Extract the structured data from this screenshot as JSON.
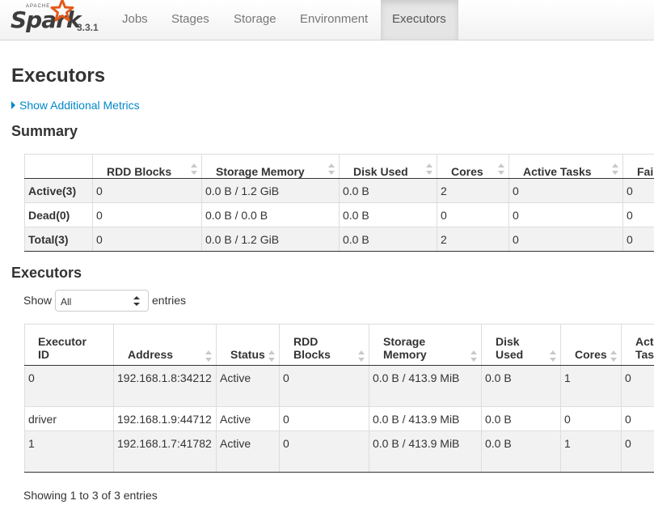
{
  "brand": {
    "apache": "APACHE",
    "name": "Spark",
    "version": "3.3.1"
  },
  "nav": {
    "tabs": [
      {
        "label": "Jobs"
      },
      {
        "label": "Stages"
      },
      {
        "label": "Storage"
      },
      {
        "label": "Environment"
      },
      {
        "label": "Executors",
        "active": true
      }
    ]
  },
  "page": {
    "title": "Executors",
    "toggle_label": "Show Additional Metrics"
  },
  "summary": {
    "title": "Summary",
    "headers": [
      "",
      "RDD Blocks",
      "Storage Memory",
      "Disk Used",
      "Cores",
      "Active Tasks",
      "Failed Tasks"
    ],
    "rows": [
      [
        "Active(3)",
        "0",
        "0.0 B / 1.2 GiB",
        "0.0 B",
        "2",
        "0",
        "0"
      ],
      [
        "Dead(0)",
        "0",
        "0.0 B / 0.0 B",
        "0.0 B",
        "0",
        "0",
        "0"
      ],
      [
        "Total(3)",
        "0",
        "0.0 B / 1.2 GiB",
        "0.0 B",
        "2",
        "0",
        "0"
      ]
    ]
  },
  "executors": {
    "title": "Executors",
    "show_label": "Show",
    "page_size": "All",
    "entries_label": "entries",
    "headers": [
      {
        "line1": "Executor",
        "line2": "ID"
      },
      {
        "line1": "",
        "line2": "Address"
      },
      {
        "line1": "",
        "line2": "Status"
      },
      {
        "line1": "RDD",
        "line2": "Blocks"
      },
      {
        "line1": "Storage",
        "line2": "Memory"
      },
      {
        "line1": "Disk",
        "line2": "Used"
      },
      {
        "line1": "",
        "line2": "Cores"
      },
      {
        "line1": "Active",
        "line2": "Tasks"
      }
    ],
    "rows": [
      [
        "0",
        "192.168.1.8:34212",
        "Active",
        "0",
        "0.0 B / 413.9 MiB",
        "0.0 B",
        "1",
        "0"
      ],
      [
        "driver",
        "192.168.1.9:44712",
        "Active",
        "0",
        "0.0 B / 413.9 MiB",
        "0.0 B",
        "0",
        "0"
      ],
      [
        "1",
        "192.168.1.7:41782",
        "Active",
        "0",
        "0.0 B / 413.9 MiB",
        "0.0 B",
        "1",
        "0"
      ]
    ],
    "info": "Showing 1 to 3 of 3 entries"
  }
}
